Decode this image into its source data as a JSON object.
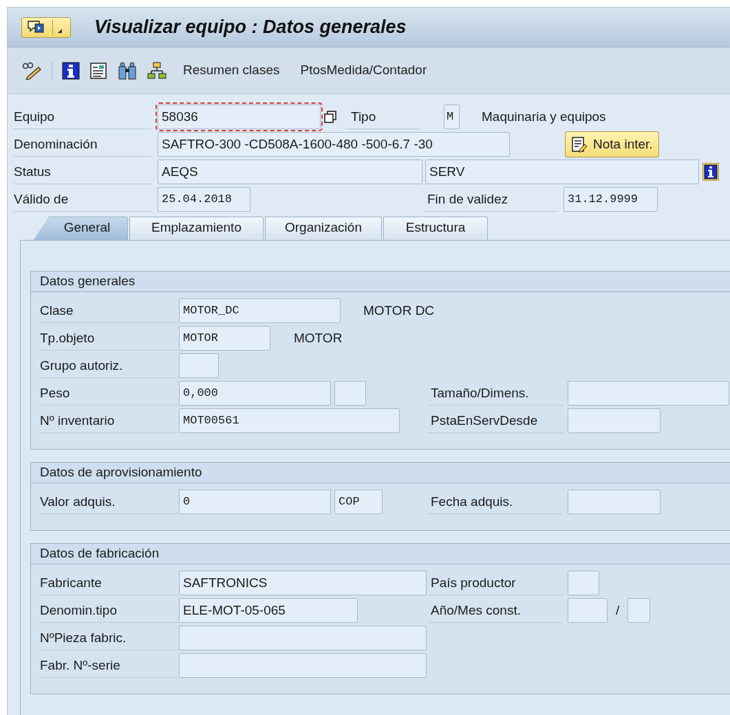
{
  "title_bar": {
    "title": "Visualizar equipo : Datos generales"
  },
  "toolbar": {
    "buttons": [
      "Resumen clases",
      "PtosMedida/Contador"
    ]
  },
  "header": {
    "equipo": {
      "label": "Equipo",
      "value": "58036",
      "focused": true
    },
    "tipo": {
      "label": "Tipo",
      "value": "M",
      "description": "Maquinaria y equipos"
    },
    "denominacion": {
      "label": "Denominación",
      "value": "SAFTRO-300 -CD508A-1600-480 -500-6.7 -30"
    },
    "note_button": "Nota inter.",
    "status": {
      "label": "Status",
      "value": "AEQS",
      "value_2": "SERV"
    },
    "valido_de": {
      "label": "Válido de",
      "value": "25.04.2018"
    },
    "fin_de_validez": {
      "label": "Fin de validez",
      "value": "31.12.9999"
    }
  },
  "tabs": [
    {
      "label": "General",
      "selected": true
    },
    {
      "label": "Emplazamiento",
      "selected": false
    },
    {
      "label": "Organización",
      "selected": false
    },
    {
      "label": "Estructura",
      "selected": false
    }
  ],
  "groups": [
    {
      "title": "Datos generales",
      "rows": [
        {
          "label": "Clase",
          "value": "MOTOR_DC",
          "description": "MOTOR DC"
        },
        {
          "label": "Tp.objeto",
          "value": "MOTOR",
          "description": "MOTOR"
        },
        {
          "label": "Grupo autoriz."
        },
        {
          "label": "Peso",
          "value": "0,000",
          "right": {
            "label": "Tamaño/Dimens."
          }
        },
        {
          "label": "Nº inventario",
          "value": "MOT00561",
          "right": {
            "label": "PstaEnServDesde"
          }
        }
      ]
    },
    {
      "title": "Datos de aprovisionamiento",
      "rows": [
        {
          "label": "Valor adquis.",
          "value": "0",
          "value_2": "COP",
          "right": {
            "label": "Fecha adquis."
          }
        }
      ]
    },
    {
      "title": "Datos de fabricación",
      "rows": [
        {
          "label": "Fabricante",
          "value": "SAFTRONICS",
          "right": {
            "label": "País productor"
          }
        },
        {
          "label": "Denomin.tipo",
          "value": "ELE-MOT-05-065",
          "right": {
            "label": "Año/Mes const.",
            "separator": "/"
          }
        },
        {
          "label": "NºPieza fabric."
        },
        {
          "label": "Fabr. Nº-serie"
        }
      ]
    }
  ]
}
